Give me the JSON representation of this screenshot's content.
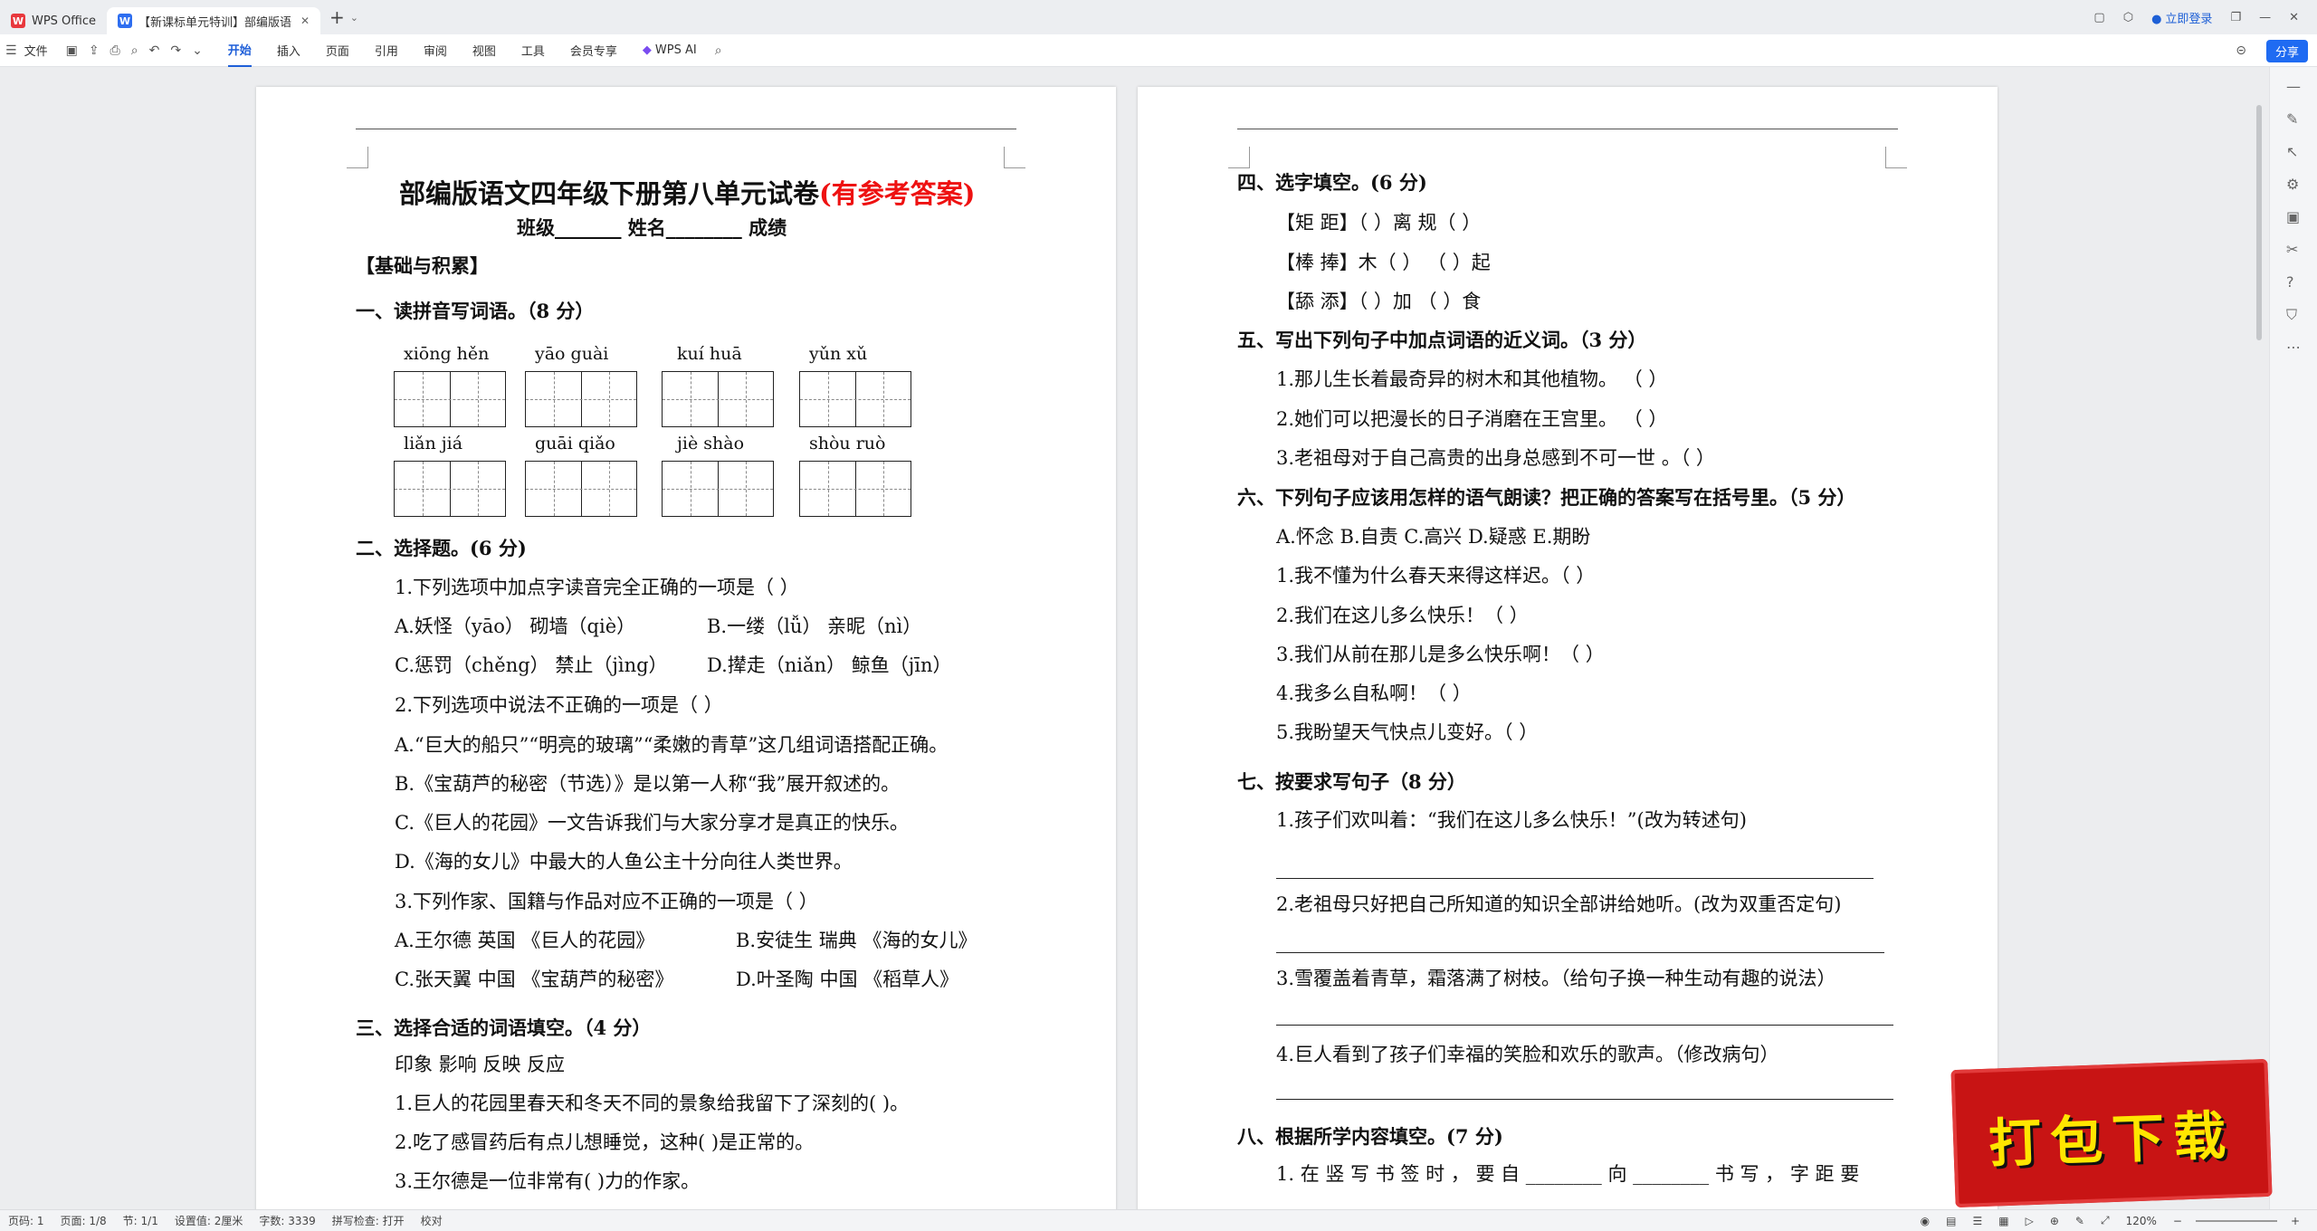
{
  "titlebar": {
    "home_tab": "WPS Office",
    "doc_tab": "【新课标单元特训】部编版语",
    "login": "立即登录"
  },
  "ribbon": {
    "file": "文件",
    "tabs": [
      "开始",
      "插入",
      "页面",
      "引用",
      "审阅",
      "视图",
      "工具",
      "会员专享"
    ],
    "ai": "WPS AI",
    "share": "分享"
  },
  "page1": {
    "title_main": "部编版语文四年级下册第八单元试卷",
    "title_red": "(有参考答案)",
    "class_line": "班级_______   姓名________  成绩",
    "basics": "【基础与积累】",
    "s1": "一、读拼音写词语。（8 分）",
    "pinyin_row1": [
      "xiōng hěn",
      "yāo guài",
      "kuí huā",
      "yǔn xǔ"
    ],
    "pinyin_row2": [
      "liǎn jiá",
      "guāi qiǎo",
      "jiè shào",
      "shòu ruò"
    ],
    "s2": "二、选择题。(6 分)",
    "q1": "1.下列选项中加点字读音完全正确的一项是（    ）",
    "q1a": "A.妖怪（yāo）   砌墙（qiè）",
    "q1b": "B.一缕（lǚ）   亲昵（nì）",
    "q1c": "C.惩罚（chěng）   禁止（jìng）",
    "q1d": "D.撵走（niǎn）   鲸鱼（jīn）",
    "q2": "2.下列选项中说法不正确的一项是（    ）",
    "q2a": "A.“巨大的船只”“明亮的玻璃”“柔嫩的青草”这几组词语搭配正确。",
    "q2b": "B.《宝葫芦的秘密（节选）》是以第一人称“我”展开叙述的。",
    "q2c": "C.《巨人的花园》一文告诉我们与大家分享才是真正的快乐。",
    "q2d": "D.《海的女儿》中最大的人鱼公主十分向往人类世界。",
    "q3": "3.下列作家、国籍与作品对应不正确的一项是（    ）",
    "q3a": "A.王尔德   英国   《巨人的花园》",
    "q3b": "B.安徒生   瑞典   《海的女儿》",
    "q3c": "C.张天翼   中国   《宝葫芦的秘密》",
    "q3d": "D.叶圣陶   中国   《稻草人》",
    "s3": "三、选择合适的词语填空。（4 分）",
    "words": "印象    影响    反映    反应",
    "f1": "1.巨人的花园里春天和冬天不同的景象给我留下了深刻的(        )。",
    "f2": "2.吃了感冒药后有点儿想睡觉，这种(       )是正常的。",
    "f3": "3.王尔德是一位非常有(       )力的作家。"
  },
  "page2": {
    "s4": "四、选字填空。(6 分)",
    "c1": "【矩   距】（      ）离      规（      ）",
    "c2": "【棒   捧】木（      ）      （      ）起",
    "c3": "【舔   添】（      ）加      （      ）食",
    "s5": "五、写出下列句子中加点词语的近义词。（3 分）",
    "n1": "1.那儿生长着最奇异的树木和其他植物。    （      ）",
    "n2": "2.她们可以把漫长的日子消磨在王宫里。    （      ）",
    "n3": "3.老祖母对于自己高贵的出身总感到不可一世 。（       ）",
    "s6": "六、下列句子应该用怎样的语气朗读？把正确的答案写在括号里。（5 分）",
    "opts": "A.怀念  B.自责  C.高兴  D.疑惑  E.期盼",
    "t1": "1.我不懂为什么春天来得这样迟。（    ）",
    "t2": "2.我们在这儿多么快乐！（    ）",
    "t3": "3.我们从前在那儿是多么快乐啊！（    ）",
    "t4": "4.我多么自私啊！（    ）",
    "t5": "5.我盼望天气快点儿变好。（    ）",
    "s7": "七、按要求写句子（8 分）",
    "w1": "1.孩子们欢叫着：“我们在这儿多么快乐！”(改为转述句)",
    "w2": "2.老祖母只好把自己所知道的知识全部讲给她听。(改为双重否定句)",
    "w3": "3.雪覆盖着青草，霜落满了树枝。（给句子换一种生动有趣的说法）",
    "w4": "4.巨人看到了孩子们幸福的笑脸和欢乐的歌声。（修改病句）",
    "s8": "八、根据所学内容填空。(7 分)",
    "k1": "1. 在 竖 写 书 签 时 ， 要 自 ________ 向 ________ 书 写 ， 字 距 要"
  },
  "status": {
    "page": "页码: 1",
    "pages": "页面: 1/8",
    "section": "节: 1/1",
    "setting": "设置值: 2厘米",
    "words": "字数: 3339",
    "spell": "拼写检查: 打开",
    "proof": "校对",
    "zoom": "120%"
  },
  "banner": {
    "text": "打包下载"
  }
}
